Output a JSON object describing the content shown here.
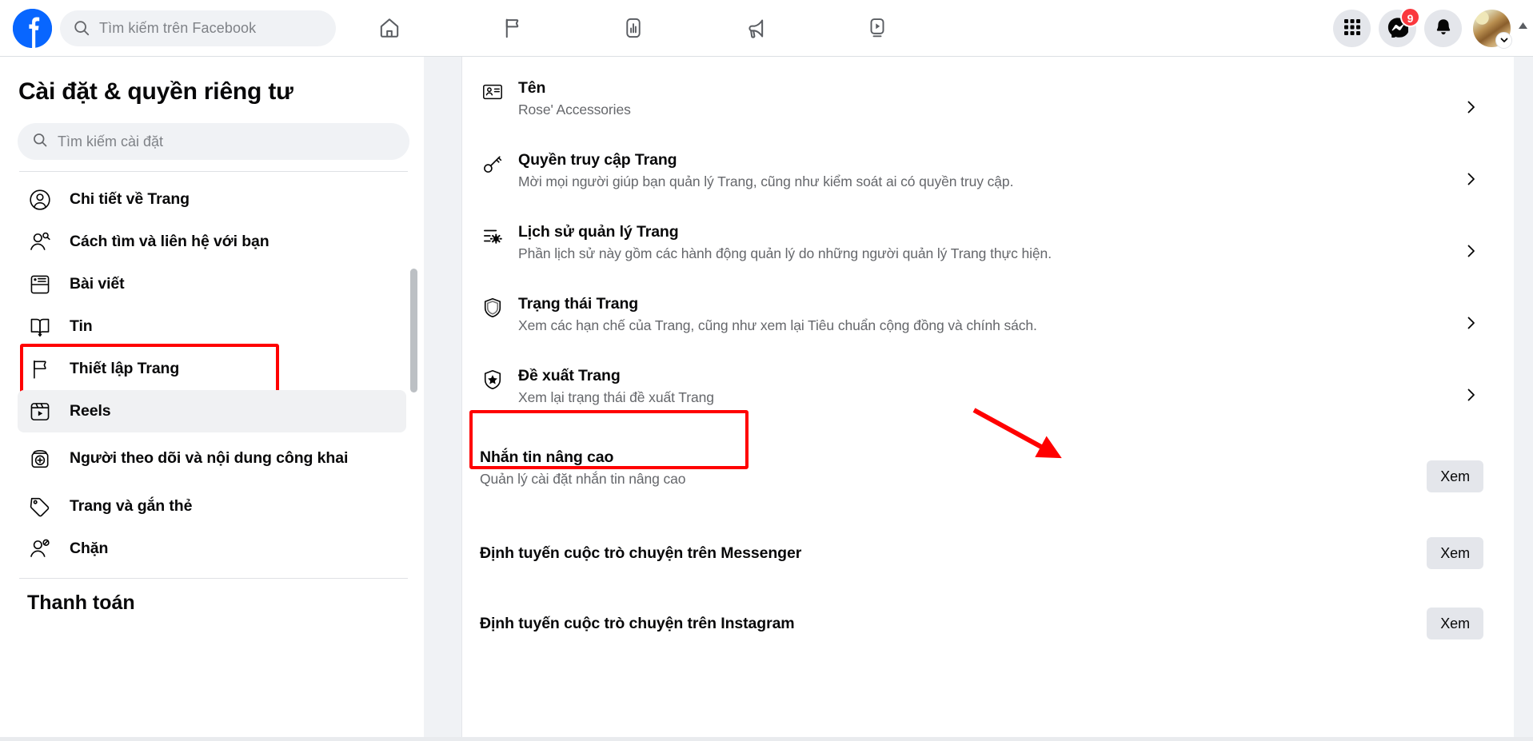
{
  "topbar": {
    "logo_name": "facebook-logo",
    "search": {
      "placeholder": "Tìm kiếm trên Facebook",
      "value": ""
    },
    "nav_tabs": [
      {
        "name": "home",
        "icon": "home-icon"
      },
      {
        "name": "pages",
        "icon": "flag-icon"
      },
      {
        "name": "insights",
        "icon": "bar-chart-icon"
      },
      {
        "name": "ads",
        "icon": "megaphone-icon"
      },
      {
        "name": "video",
        "icon": "video-play-icon"
      }
    ],
    "actions": {
      "menu_icon": "grid-menu-icon",
      "messenger_icon": "messenger-icon",
      "messenger_badge": "9",
      "notifications_icon": "bell-icon",
      "avatar": "profile-avatar",
      "avatar_caret": "chevron-down-icon"
    },
    "accent_color": "#0866ff",
    "badge_color": "#fa383e"
  },
  "sidebar": {
    "title": "Cài đặt & quyền riêng tư",
    "search": {
      "placeholder": "Tìm kiếm cài đặt",
      "value": ""
    },
    "items": [
      {
        "label": "Chi tiết về Trang",
        "icon": "person-circle-icon",
        "state": "default"
      },
      {
        "label": "Cách tìm và liên hệ với bạn",
        "icon": "person-search-icon",
        "state": "default"
      },
      {
        "label": "Bài viết",
        "icon": "post-card-icon",
        "state": "default"
      },
      {
        "label": "Tin",
        "icon": "book-icon",
        "state": "default"
      },
      {
        "label": "Thiết lập Trang",
        "icon": "flag-icon",
        "state": "highlighted"
      },
      {
        "label": "Reels",
        "icon": "reels-icon",
        "state": "hovered"
      },
      {
        "label": "Người theo dõi và nội dung công khai",
        "icon": "follower-add-icon",
        "state": "default"
      },
      {
        "label": "Trang và gắn thẻ",
        "icon": "tag-icon",
        "state": "default"
      },
      {
        "label": "Chặn",
        "icon": "person-block-icon",
        "state": "default"
      }
    ],
    "section_heading": "Thanh toán"
  },
  "main": {
    "rows": [
      {
        "title": "Tên",
        "desc": "Rose' Accessories",
        "icon": "id-card-icon",
        "action": "chevron",
        "action_label": ""
      },
      {
        "title": "Quyền truy cập Trang",
        "desc": "Mời mọi người giúp bạn quản lý Trang, cũng như kiểm soát ai có quyền truy cập.",
        "icon": "key-icon",
        "action": "chevron",
        "action_label": ""
      },
      {
        "title": "Lịch sử quản lý Trang",
        "desc": "Phần lịch sử này gồm các hành động quản lý do những người quản lý Trang thực hiện.",
        "icon": "settings-sliders-icon",
        "action": "chevron",
        "action_label": ""
      },
      {
        "title": "Trạng thái Trang",
        "desc": "Xem các hạn chế của Trang, cũng như xem lại Tiêu chuẩn cộng đồng và chính sách.",
        "icon": "shield-icon",
        "action": "chevron",
        "action_label": ""
      },
      {
        "title": "Đề xuất Trang",
        "desc": "Xem lại trạng thái đề xuất Trang",
        "icon": "shield-star-icon",
        "action": "chevron",
        "action_label": ""
      },
      {
        "title": "Nhắn tin nâng cao",
        "desc": "Quản lý cài đặt nhắn tin nâng cao",
        "icon": "none",
        "action": "button",
        "action_label": "Xem",
        "highlighted": true
      },
      {
        "title": "Định tuyến cuộc trò chuyện trên Messenger",
        "desc": "",
        "icon": "none",
        "action": "button",
        "action_label": "Xem"
      },
      {
        "title": "Định tuyến cuộc trò chuyện trên Instagram",
        "desc": "",
        "icon": "none",
        "action": "button",
        "action_label": "Xem"
      }
    ]
  },
  "annotations": {
    "highlight_color": "#ff0000",
    "arrow": "red-arrow-pointing-to-xem-button",
    "boxes": [
      "sidebar-item-thiet-lap-trang",
      "row-nhan-tin-nang-cao"
    ]
  }
}
